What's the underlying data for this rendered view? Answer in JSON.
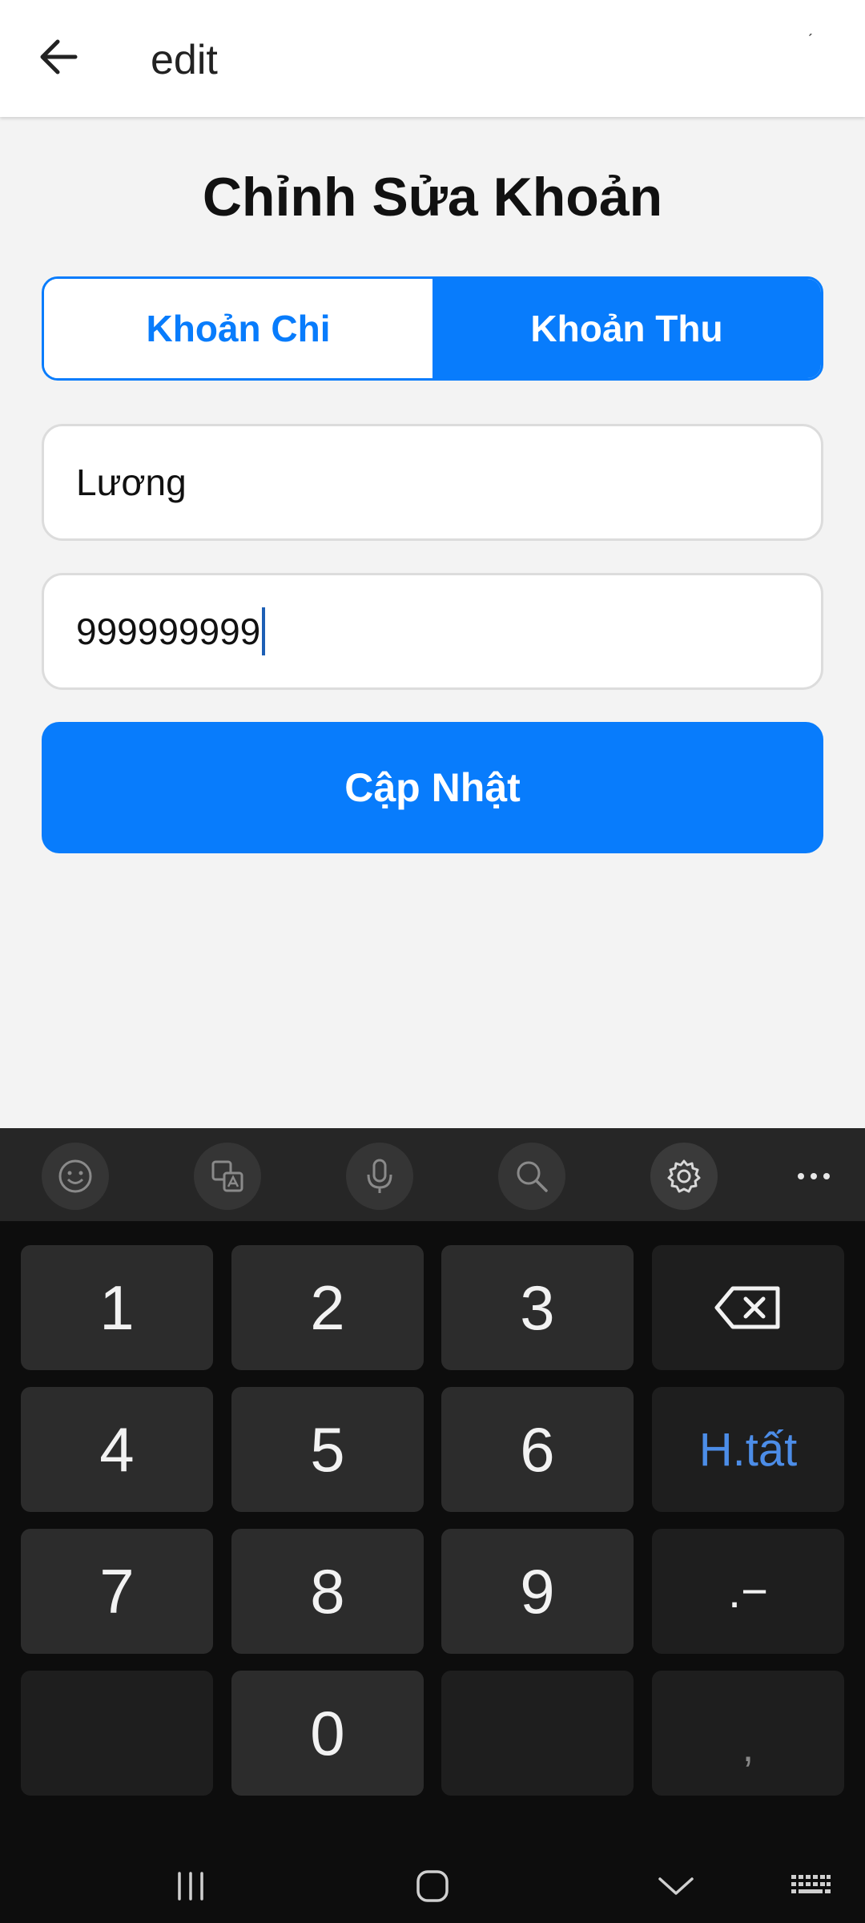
{
  "appbar": {
    "title": "edit",
    "tick": "ˊ"
  },
  "heading": "Chỉnh Sửa Khoản",
  "segment": {
    "expense_label": "Khoản Chi",
    "income_label": "Khoản Thu",
    "selected": "Khoản Thu"
  },
  "form": {
    "name_value": "Lương",
    "amount_value": "999999999"
  },
  "submit_label": "Cập Nhật",
  "keyboard": {
    "toolbar": [
      "emoji-icon",
      "translate-icon",
      "microphone-icon",
      "search-icon",
      "gear-icon",
      "more-icon"
    ],
    "keys": {
      "k1": "1",
      "k2": "2",
      "k3": "3",
      "k4": "4",
      "k5": "5",
      "k6": "6",
      "k7": "7",
      "k8": "8",
      "k9": "9",
      "k0": "0",
      "done": "H.tất",
      "dotminus": ".−",
      "comma": ","
    }
  },
  "colors": {
    "accent": "#087cfc",
    "keyboard_bg": "#0d0d0d",
    "key_bg": "#2c2c2c",
    "done_text": "#4c8de8"
  }
}
